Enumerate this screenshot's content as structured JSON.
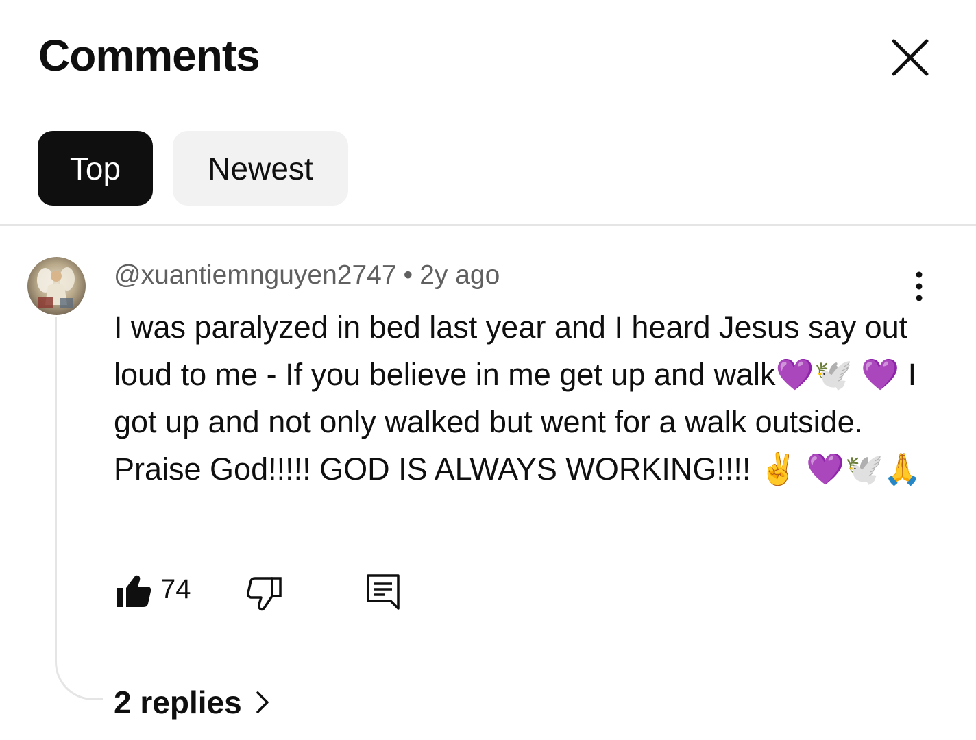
{
  "header": {
    "title": "Comments",
    "close_icon": "close-icon"
  },
  "sort_tabs": [
    {
      "label": "Top",
      "selected": true
    },
    {
      "label": "Newest",
      "selected": false
    }
  ],
  "comment": {
    "author": "@xuantiemnguyen2747",
    "separator": "•",
    "time": "2y ago",
    "text": "I was paralyzed in bed last year and I heard Jesus say out loud to me - If you believe in me get up and walk💜🕊️ 💜 I got up and not only walked but went for a walk outside.  Praise God!!!!! GOD IS ALWAYS WORKING!!!! ✌️ 💜🕊️🙏",
    "like_count": "74",
    "replies_label": "2 replies",
    "icons": {
      "avatar": "avatar",
      "more": "more-vert-icon",
      "like": "thumbs-up-filled-icon",
      "dislike": "thumbs-down-icon",
      "reply": "comment-reply-icon",
      "chevron": "chevron-right-icon"
    }
  },
  "colors": {
    "text_primary": "#0f0f0f",
    "text_secondary": "#606060",
    "chip_selected_bg": "#0f0f0f",
    "chip_unselected_bg": "#f2f2f2",
    "divider": "#e5e5e5"
  }
}
